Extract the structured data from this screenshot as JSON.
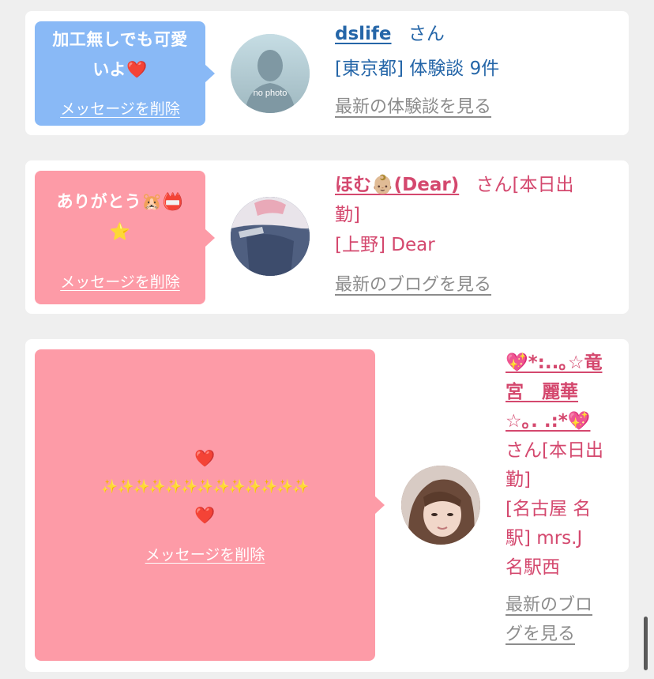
{
  "cards": [
    {
      "message_line1": "加工無しでも可愛",
      "message_line2": "いよ❤️",
      "delete_label": "メッセージを削除",
      "avatar_text": "no photo",
      "name": "dslife",
      "suffix": "さん",
      "area_line": "[東京都] 体験談 9件",
      "link": "最新の体験談を見る",
      "accent": "#2566a8"
    },
    {
      "message_line1": "ありがとう🐹📛",
      "message_line2": "⭐",
      "delete_label": "メッセージを削除",
      "name": "ほむ👶🏼(Dear)",
      "suffix_line1": "さん[本日出",
      "suffix_line2": "勤]",
      "area_line": "[上野] Dear",
      "link": "最新のブログを見る",
      "accent": "#d4486e"
    },
    {
      "message_line1": "❤️",
      "message_line2": "✨✨✨✨✨✨✨✨✨✨✨✨✨",
      "message_line3": "❤️",
      "delete_label": "メッセージを削除",
      "name_line1": "💖*:..｡☆竜",
      "name_line2": "宮　麗華",
      "name_line3": "☆｡. .:*💖",
      "suffix_line1": "さん[本日出",
      "suffix_line2": "勤]",
      "area_line1": "[名古屋 名",
      "area_line2": "駅] mrs.J",
      "area_line3": "名駅西",
      "link_line1": "最新のブロ",
      "link_line2": "グを見る",
      "accent": "#d4486e"
    }
  ]
}
